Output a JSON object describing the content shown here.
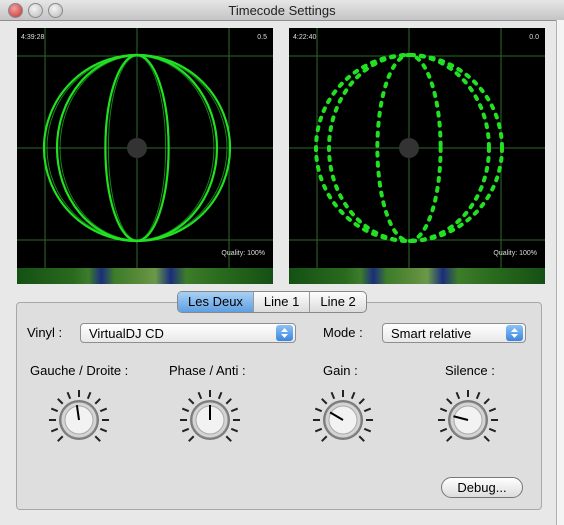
{
  "window": {
    "title": "Timecode Settings"
  },
  "scopes": [
    {
      "time": "4:39:28",
      "value": "0.5",
      "quality": "Quality: 100%",
      "style": "solid"
    },
    {
      "time": "4:22:40",
      "value": "0.0",
      "quality": "Quality: 100%",
      "style": "dotted"
    }
  ],
  "tabs": [
    "Les Deux",
    "Line 1",
    "Line 2"
  ],
  "active_tab": "Les Deux",
  "vinyl": {
    "label": "Vinyl :",
    "value": "VirtualDJ CD"
  },
  "mode": {
    "label": "Mode :",
    "value": "Smart relative"
  },
  "knobs": [
    {
      "label": "Gauche / Droite :",
      "level": 0.47
    },
    {
      "label": "Phase / Anti :",
      "level": 0.5
    },
    {
      "label": "Gain :",
      "level": 0.28
    },
    {
      "label": "Silence :",
      "level": 0.22
    }
  ],
  "debug_label": "Debug...",
  "colors": {
    "trace": "#22e022",
    "accent": "#3a86de"
  }
}
